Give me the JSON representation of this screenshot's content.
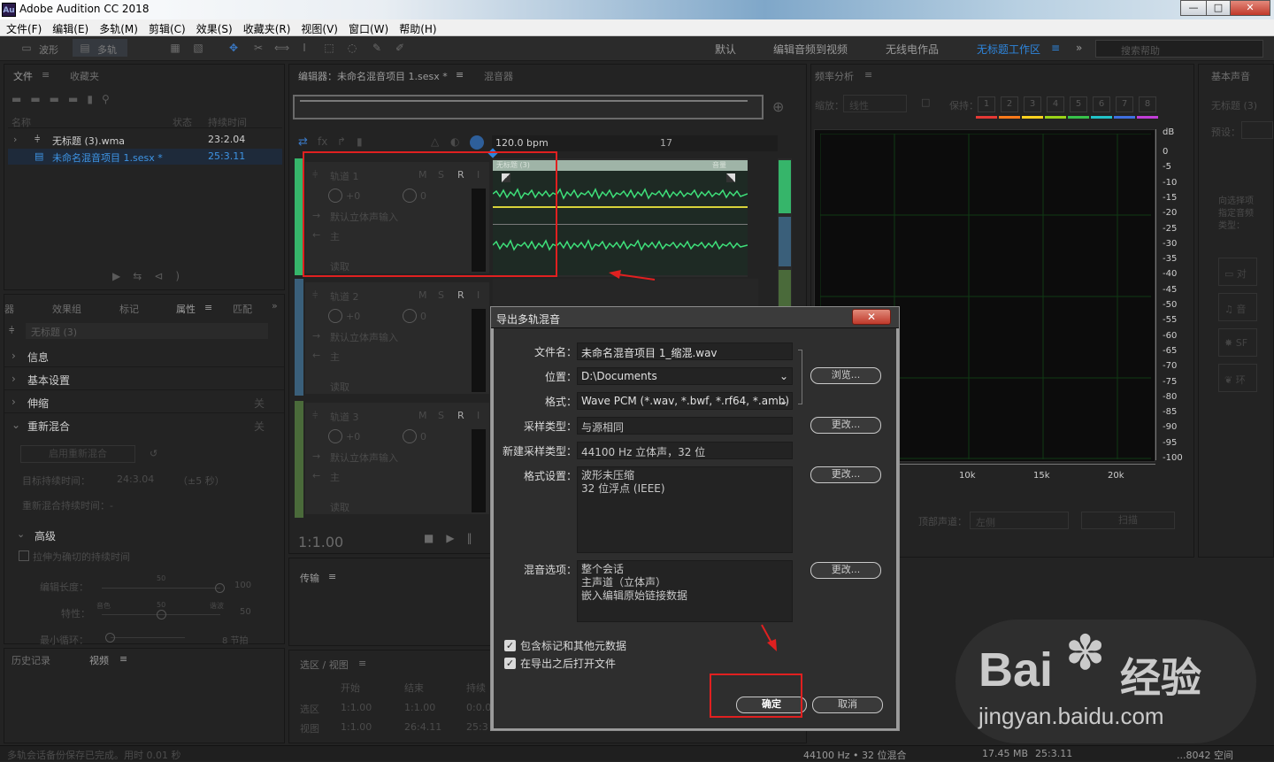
{
  "window": {
    "app_icon": "Au",
    "title": "Adobe Audition CC 2018",
    "btn_min": "—",
    "btn_max": "□",
    "btn_close": "✕"
  },
  "menu": [
    "文件(F)",
    "编辑(E)",
    "多轨(M)",
    "剪辑(C)",
    "效果(S)",
    "收藏夹(R)",
    "视图(V)",
    "窗口(W)",
    "帮助(H)"
  ],
  "toolbar": {
    "waveform": "波形",
    "multitrack": "多轨"
  },
  "workspaces": [
    "默认",
    "编辑音频到视频",
    "无线电作品",
    "无标题工作区"
  ],
  "workspace_menu": "≡",
  "workspace_more": "»",
  "search_placeholder": "搜索帮助",
  "files": {
    "tabs": [
      "文件",
      "收藏夹"
    ],
    "tab_menu": "≡",
    "columns": {
      "name": "名称",
      "status": "状态",
      "duration": "持续时间"
    },
    "rows": [
      {
        "name": "无标题 (3).wma",
        "duration": "23:2.04"
      },
      {
        "name": "未命名混音项目 1.sesx *",
        "duration": "25:3.11"
      }
    ]
  },
  "props": {
    "tabs": [
      "器",
      "效果组",
      "标记",
      "属性",
      "匹配"
    ],
    "tab_menu": "≡",
    "more": "»",
    "clip": "无标题 (3)",
    "sections": [
      "信息",
      "基本设置",
      "伸缩",
      "重新混合"
    ],
    "section_off": "关",
    "enable_remix": "启用重新混合",
    "target_label": "目标持续时间：",
    "target_value": "24:3.04",
    "target_hint": "（±5 秒）",
    "remix_duration": "重新混合持续时间：-",
    "advanced": "高级",
    "stretch": "拉伸为确切的持续时间",
    "edit_len": "编辑长度：",
    "feature": "特性：",
    "min_loop": "最小循环：",
    "slider_mid": "50",
    "slider_max": "100",
    "feature_left": "音色",
    "feature_right": "谐波",
    "feature_val": "50",
    "loop_val": "8 节拍"
  },
  "history": {
    "tabs": [
      "历史记录",
      "视频"
    ]
  },
  "editor": {
    "tab": "编辑器：未命名混音项目 1.sesx *",
    "mixer": "混音器",
    "tempo": "120.0 bpm",
    "bar17": "17",
    "time": "1:1.00",
    "clip_title": "无标题 (3)",
    "clip_fx": "音量",
    "fx_icon": "fx",
    "tracks": [
      {
        "name": "轨道 1",
        "input": "默认立体声输入",
        "output": "主",
        "mode": "读取",
        "vol": "+0",
        "pan": "0"
      },
      {
        "name": "轨道 2",
        "input": "默认立体声输入",
        "output": "主",
        "mode": "读取",
        "vol": "+0",
        "pan": "0"
      },
      {
        "name": "轨道 3",
        "input": "默认立体声输入",
        "output": "主",
        "mode": "读取",
        "vol": "+0",
        "pan": "0"
      }
    ],
    "msr": [
      "M",
      "S",
      "R",
      "I"
    ]
  },
  "transport": {
    "label": "传输"
  },
  "selection": {
    "title": "选区 / 视图",
    "cols": [
      "开始",
      "结束",
      "持续"
    ],
    "rows": [
      {
        "label": "选区",
        "start": "1:1.00",
        "end": "1:1.00",
        "dur": "0:0.0"
      },
      {
        "label": "视图",
        "start": "1:1.00",
        "end": "26:4.11",
        "dur": "25:3"
      }
    ]
  },
  "freq": {
    "title": "频率分析",
    "scale_label": "缩放：",
    "scale": "线性",
    "hold_label": "保持：",
    "holds": [
      "1",
      "2",
      "3",
      "4",
      "5",
      "6",
      "7",
      "8"
    ],
    "hold_colors": [
      "#e53935",
      "#ff7a1a",
      "#ffd21f",
      "#9ad318",
      "#37c24a",
      "#22c3c8",
      "#3f6fe0",
      "#c13ed8"
    ],
    "db_unit": "dB",
    "db_ticks": [
      "0",
      "-5",
      "-10",
      "-15",
      "-20",
      "-25",
      "-30",
      "-35",
      "-40",
      "-45",
      "-50",
      "-55",
      "-60",
      "-65",
      "-70",
      "-75",
      "-80",
      "-85",
      "-90",
      "-95",
      "-100"
    ],
    "hz_ticks": [
      "10k",
      "15k",
      "20k"
    ],
    "top_channel_label": "顶部声道：",
    "top_channel": "左侧",
    "scan": "扫描"
  },
  "essential": {
    "title": "基本声音",
    "clip": "无标题 (3)",
    "preset": "预设：",
    "hint": "向选择项指定音频类型：",
    "types": [
      "对",
      "音",
      "SF",
      "环"
    ]
  },
  "dialog": {
    "title": "导出多轨混音",
    "close": "✕",
    "filename_label": "文件名：",
    "filename": "未命名混音项目 1_缩混.wav",
    "location_label": "位置：",
    "location": "D:\\Documents",
    "browse": "浏览...",
    "format_label": "格式：",
    "format": "Wave PCM (*.wav, *.bwf, *.rf64, *.amb)",
    "sample_type_label": "采样类型：",
    "sample_type": "与源相同",
    "new_sample_label": "新建采样类型：",
    "new_sample": "44100 Hz 立体声，32 位",
    "format_settings_label": "格式设置：",
    "format_settings": [
      "波形未压缩",
      "32 位浮点 (IEEE)"
    ],
    "mix_label": "混音选项：",
    "mix_options": [
      "整个会话",
      "主声道（立体声）",
      "嵌入编辑原始链接数据"
    ],
    "change": "更改...",
    "chk1": "包含标记和其他元数据",
    "chk2": "在导出之后打开文件",
    "ok": "确定",
    "cancel": "取消"
  },
  "status": {
    "left": "多轨会话备份保存已完成。用时 0.01 秒",
    "format": "44100 Hz • 32 位混合",
    "size": "17.45 MB",
    "duration": "25:3.11",
    "free": "...8042 空间"
  },
  "watermark": {
    "brand": "Bai",
    "brand2": "经验",
    "url": "jingyan.baidu.com"
  }
}
